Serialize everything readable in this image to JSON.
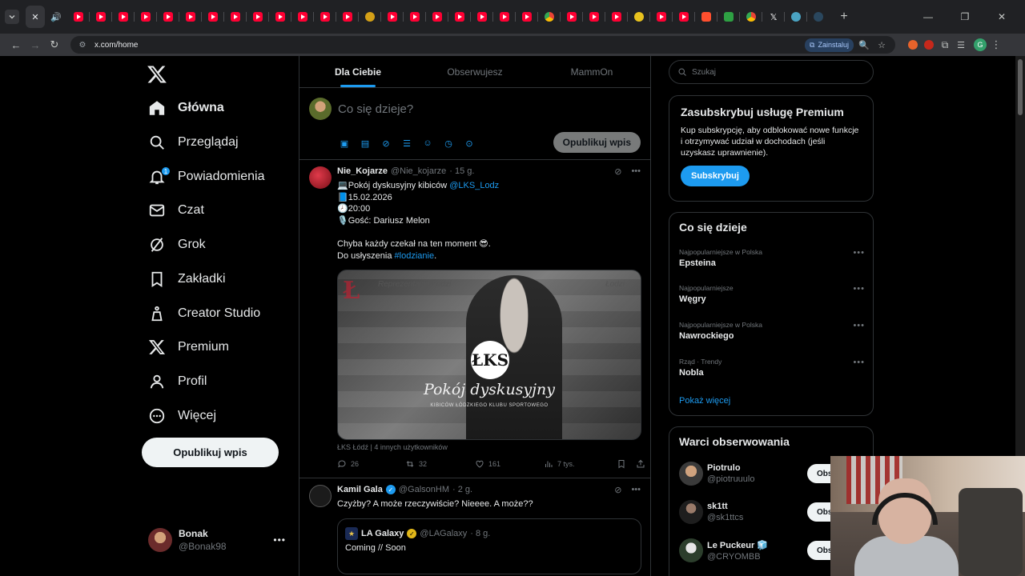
{
  "browser": {
    "url": "x.com/home",
    "install_label": "Zainstaluj",
    "profile_initial": "G"
  },
  "nav": {
    "items": [
      {
        "label": "Główna",
        "icon": "home-icon"
      },
      {
        "label": "Przeglądaj",
        "icon": "search-icon"
      },
      {
        "label": "Powiadomienia",
        "icon": "bell-icon"
      },
      {
        "label": "Czat",
        "icon": "mail-icon"
      },
      {
        "label": "Grok",
        "icon": "grok-icon"
      },
      {
        "label": "Zakładki",
        "icon": "bookmark-icon"
      },
      {
        "label": "Creator Studio",
        "icon": "creator-icon"
      },
      {
        "label": "Premium",
        "icon": "x-logo-icon"
      },
      {
        "label": "Profil",
        "icon": "person-icon"
      },
      {
        "label": "Więcej",
        "icon": "more-circle-icon"
      }
    ],
    "notification_count": "1",
    "post_button": "Opublikuj wpis",
    "account": {
      "display_name": "Bonak",
      "handle": "@Bonak98"
    }
  },
  "feed": {
    "tabs": [
      "Dla Ciebie",
      "Obserwujesz",
      "MammOn"
    ],
    "composer": {
      "placeholder": "Co się dzieje?",
      "post_label": "Opublikuj wpis"
    },
    "tweet1": {
      "name": "Nie_Kojarze",
      "handle": "@Nie_kojarze",
      "time": "· 15 g.",
      "line1_pre": "💻Pokój dyskusyjny kibiców ",
      "line1_link": "@LKS_Lodz",
      "line2": "📘15.02.2026",
      "line3": "🕗20:00",
      "line4": "🎙️Gość: Dariusz Melon",
      "line5": "Chyba każdy czekał na ten moment 😎.",
      "line6_pre": "Do usłyszenia ",
      "line6_link": "#lodzianie",
      "line6_post": ".",
      "media_caption": "Pokój dyskusyjny",
      "media_subcaption": "KIBICÓW ŁÓDZKIEGO KLUBU SPORTOWEGO",
      "media_bg_text": "Reprezentacja Łodzi",
      "media_bg_text2": "Łodzi",
      "media_emblem": "ŁKS",
      "tagged": "ŁKS Łódź | 4 innych użytkowników",
      "replies": "26",
      "reposts": "32",
      "likes": "161",
      "views": "7 tys."
    },
    "tweet2": {
      "name": "Kamil Gala",
      "handle": "@GalsonHM",
      "time": "· 2 g.",
      "text": "Czyżby? A może rzeczywiście? Nieeee. A może??",
      "quote": {
        "name": "LA Galaxy",
        "handle": "@LAGalaxy",
        "time": "· 8 g.",
        "text": "Coming // Soon"
      }
    }
  },
  "sidebar": {
    "search_placeholder": "Szukaj",
    "premium": {
      "title": "Zasubskrybuj usługę Premium",
      "text": "Kup subskrypcję, aby odblokować nowe funkcje i otrzymywać udział w dochodach (jeśli uzyskasz uprawnienie).",
      "button": "Subskrybuj"
    },
    "trends_title": "Co się dzieje",
    "trends": [
      {
        "context": "Najpopularniejsze w Polska",
        "topic": "Epsteina"
      },
      {
        "context": "Najpopularniejsze",
        "topic": "Węgry"
      },
      {
        "context": "Najpopularniejsze w Polska",
        "topic": "Nawrockiego"
      },
      {
        "context": "Rząd · Trendy",
        "topic": "Nobla"
      }
    ],
    "show_more": "Pokaż więcej",
    "follow_title": "Warci obserwowania",
    "follow": [
      {
        "name": "Piotrulo",
        "handle": "@piotruuulo",
        "button": "Obs"
      },
      {
        "name": "sk1tt",
        "handle": "@sk1ttcs",
        "button": "Obs"
      },
      {
        "name": "Le Puckeur 🧊",
        "handle": "@CRYOMBB",
        "button": "Obs"
      }
    ]
  },
  "colors": {
    "accent": "#1d9bf0",
    "background": "#000000",
    "border": "#2f3336",
    "muted": "#71767b"
  }
}
